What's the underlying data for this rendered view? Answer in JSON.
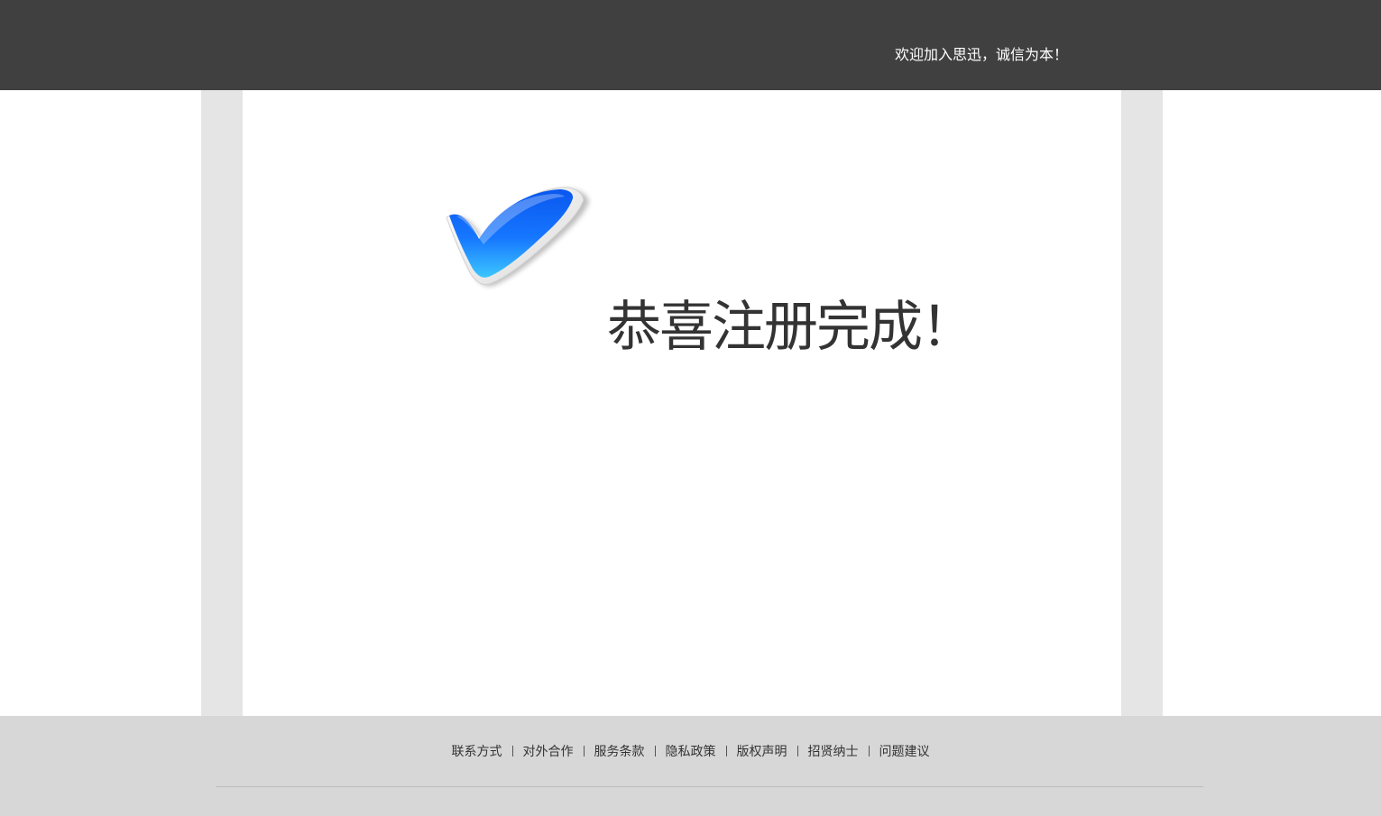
{
  "header": {
    "welcome_text": "欢迎加入思迅，诚信为本！"
  },
  "main": {
    "success_icon": "checkmark-icon",
    "success_title": "恭喜注册完成！",
    "colors": {
      "check_blue": "#0a6cf0",
      "check_light": "#39c0ff",
      "title_text": "#333333"
    }
  },
  "footer": {
    "links": [
      {
        "label": "联系方式"
      },
      {
        "label": "对外合作"
      },
      {
        "label": "服务条款"
      },
      {
        "label": "隐私政策"
      },
      {
        "label": "版权声明"
      },
      {
        "label": "招贤纳士"
      },
      {
        "label": "问题建议"
      }
    ]
  },
  "colors": {
    "header_bg": "#404040",
    "side_panel": "#e5e5e5",
    "footer_bg": "#d7d7d7"
  }
}
